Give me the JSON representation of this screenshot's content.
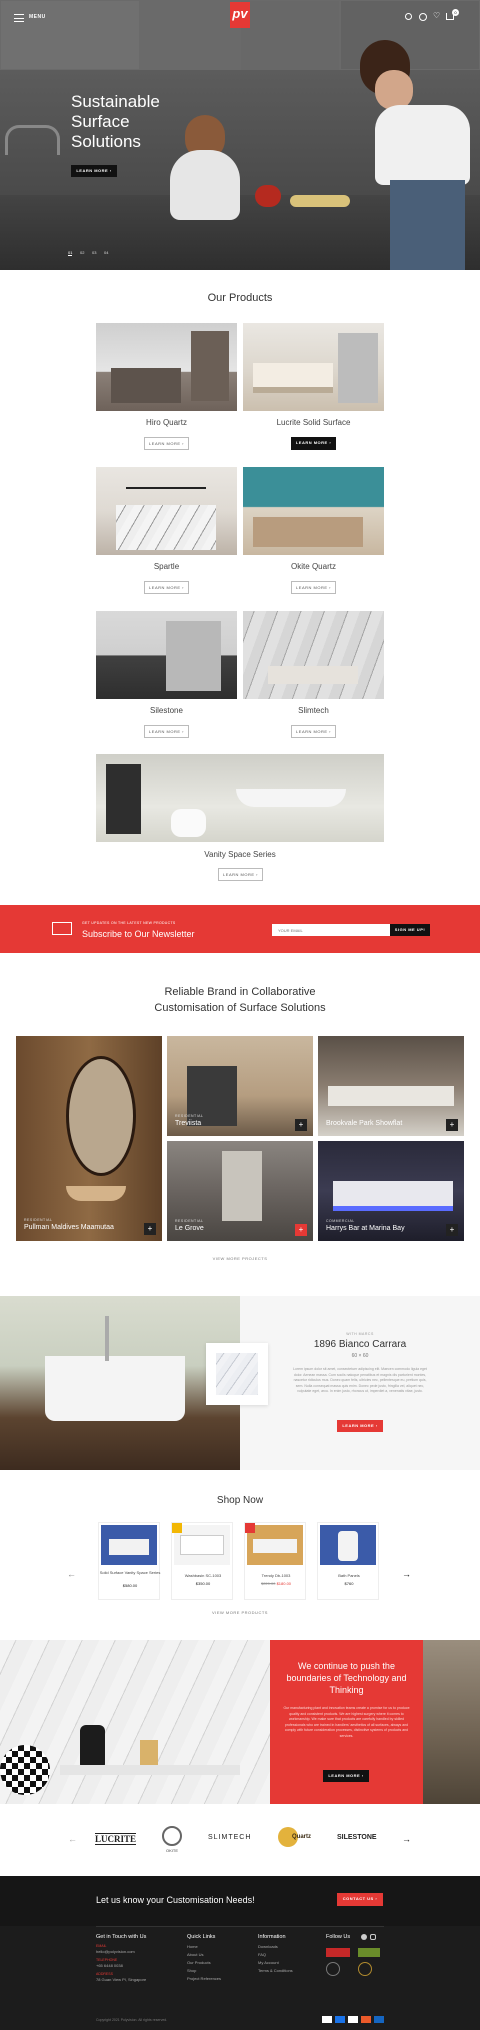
{
  "colors": {
    "accent": "#e53935",
    "dark": "#111111",
    "footer": "#1c1c1c"
  },
  "header": {
    "menu_icon": "hamburger-icon",
    "menu_label": "MENU",
    "logo_text": "pv",
    "icons": [
      "search-icon",
      "user-icon",
      "heart-icon",
      "cart-icon"
    ],
    "cart_count": "0"
  },
  "hero": {
    "title_lines": [
      "Sustainable",
      "Surface",
      "Solutions"
    ],
    "cta": "LEARN MORE",
    "slides": [
      "01",
      "02",
      "03",
      "04"
    ]
  },
  "products": {
    "title": "Our Products",
    "items": [
      {
        "name": "Hiro Quartz",
        "cta": "LEARN MORE"
      },
      {
        "name": "Lucrite Solid Surface",
        "cta": "LEARN MORE"
      },
      {
        "name": "Spartle",
        "cta": "LEARN MORE"
      },
      {
        "name": "Okite Quartz",
        "cta": "LEARN MORE"
      },
      {
        "name": "Silestone",
        "cta": "LEARN MORE"
      },
      {
        "name": "Slimtech",
        "cta": "LEARN MORE"
      },
      {
        "name": "Vanity Space Series",
        "cta": "LEARN MORE"
      }
    ]
  },
  "newsletter": {
    "kicker": "GET UPDATES ON THE LATEST NEW PRODUCTS",
    "title": "Subscribe to Our Newsletter",
    "placeholder": "YOUR EMAIL",
    "button": "SIGN ME UP!"
  },
  "projects": {
    "title_line1": "Reliable Brand in Collaborative",
    "title_line2": "Customisation of Surface Solutions",
    "items": [
      {
        "category": "RESIDENTIAL",
        "name": "Pullman Maldives Maamutaa"
      },
      {
        "category": "RESIDENTIAL",
        "name": "Treviista"
      },
      {
        "category": "",
        "name": "Brookvale Park Showflat"
      },
      {
        "category": "RESIDENTIAL",
        "name": "Le Grove"
      },
      {
        "category": "COMMERCIAL",
        "name": "Harrys Bar at Marina Bay"
      }
    ],
    "view_more": "VIEW MORE PROJECTS"
  },
  "feature": {
    "kicker": "WITH MARCS",
    "title": "1896 Bianco Carrara",
    "subtitle": "60 × 60",
    "body": "Lorem ipsum dolor sit amet, consectetuer adipiscing elit. Maecen commodo ligula eget dolor. Aenean massa. Cum sociis natoque penatibus et magnis dis parturient montes, nascetur ridiculus mus. Donec quam felis, ultricies nec, pellentesque eu, pretium quis, sem. Nulla consequat massa quis enim. Donec pede justo, fringilla vel, aliquet nec, vulputate eget, arcu. In enim justo, rhoncus ut, imperdiet a, venenatis vitae, justo.",
    "cta": "LEARN MORE"
  },
  "shop": {
    "title": "Shop Now",
    "items": [
      {
        "name": "Solid Surface Vanity Space Series",
        "price": "$580.00",
        "old_price": ""
      },
      {
        "name": "Washbasin SC-1003",
        "price": "$350.00",
        "old_price": ""
      },
      {
        "name": "Trendy Db-1003",
        "price": "$180.00",
        "old_price": "$220.00"
      },
      {
        "name": "Bath Panels",
        "price": "$760",
        "old_price": ""
      }
    ],
    "view_more": "VIEW MORE PRODUCTS"
  },
  "promo": {
    "title": "We continue to push the boundaries of Technology and Thinking",
    "body": "Our manufacturing plant and innovation teams create a promise for us to produce quality and consistent products. We are highest surgery where it comes to workmanship. We make sure that products are carefully handled by skilled professionals who are trained in handlers' aesthetics of all surfaces, always and comply with future consideration processes, distinctive systems of products and services.",
    "cta": "LEARN MORE"
  },
  "brands": [
    "LUCRITE",
    "OKITE",
    "SLIMTECH",
    "Quartz",
    "SILESTONE"
  ],
  "cta_bar": {
    "text": "Let us know your Customisation Needs!",
    "button": "CONTACT US"
  },
  "footer": {
    "contact_title": "Get in Touch with Us",
    "email_label": "EMAIL",
    "email": "hello@polyvision.com",
    "phone_label": "TELEPHONE",
    "phone": "+65 6448 0038",
    "address_label": "ADDRESS",
    "address": "78 Guan View Pl, Singapore",
    "quick_title": "Quick Links",
    "quick": [
      "Home",
      "About Us",
      "Our Products",
      "Shop",
      "Project References"
    ],
    "info_title": "Information",
    "info": [
      "Downloads",
      "FAQ",
      "My Account",
      "Terms & Conditions"
    ],
    "follow_title": "Follow Us",
    "copyright": "Copyright 2021 Polyvision. All rights reserved."
  }
}
